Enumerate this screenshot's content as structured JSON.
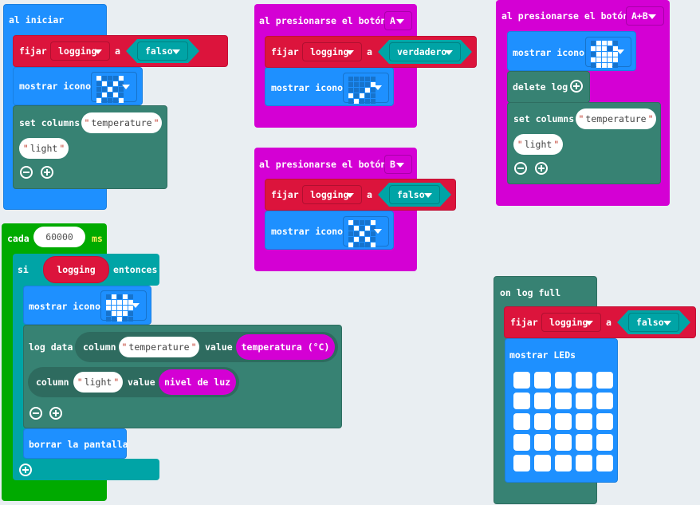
{
  "colors": {
    "basic": "#1e90ff",
    "variables": "#dc143c",
    "logic": "#00a4a6",
    "loops": "#00aa00",
    "input": "#d400d4",
    "datalogger": "#378273",
    "workspace": "#e9eef2"
  },
  "icons": {
    "no": [
      "10001",
      "01010",
      "00100",
      "01010",
      "10001"
    ],
    "yes": [
      "00000",
      "00001",
      "00010",
      "10100",
      "01000"
    ],
    "heart": [
      "01010",
      "11111",
      "11111",
      "01110",
      "00100"
    ],
    "ab_icon": [
      "01110",
      "11101",
      "01111",
      "11111",
      "01110"
    ]
  },
  "on_start": {
    "title": "al iniciar",
    "set": {
      "label": "fijar",
      "var": "logging",
      "to": "a",
      "value": "falso"
    },
    "show_icon": {
      "label": "mostrar icono",
      "icon": "no"
    },
    "set_columns": {
      "label": "set columns",
      "col1": "temperature",
      "col2": "light"
    }
  },
  "button_a": {
    "title": "al presionarse el botón",
    "button": "A",
    "set": {
      "label": "fijar",
      "var": "logging",
      "to": "a",
      "value": "verdadero"
    },
    "show_icon": {
      "label": "mostrar icono",
      "icon": "yes"
    }
  },
  "button_b": {
    "title": "al presionarse el botón",
    "button": "B",
    "set": {
      "label": "fijar",
      "var": "logging",
      "to": "a",
      "value": "falso"
    },
    "show_icon": {
      "label": "mostrar icono",
      "icon": "no"
    }
  },
  "button_ab": {
    "title": "al presionarse el botón",
    "button": "A+B",
    "show_icon": {
      "label": "mostrar icono",
      "icon": "ab_icon"
    },
    "delete_log": {
      "label": "delete log"
    },
    "set_columns": {
      "label": "set columns",
      "col1": "temperature",
      "col2": "light"
    }
  },
  "every": {
    "label": "cada",
    "interval": "60000",
    "unit": "ms",
    "if": {
      "label": "si",
      "condition": "logging",
      "then": "entonces"
    },
    "show_icon": {
      "label": "mostrar icono",
      "icon": "heart"
    },
    "log_data": {
      "label": "log data",
      "column_label": "column",
      "value_label": "value",
      "col1": "temperature",
      "val1": "temperatura (°C)",
      "col2": "light",
      "val2": "nivel de luz"
    },
    "clear": {
      "label": "borrar la pantalla"
    }
  },
  "log_full": {
    "title": "on log full",
    "set": {
      "label": "fijar",
      "var": "logging",
      "to": "a",
      "value": "falso"
    },
    "show_leds": {
      "label": "mostrar LEDs",
      "leds": [
        "00000",
        "00000",
        "00000",
        "00000",
        "00000"
      ]
    }
  }
}
